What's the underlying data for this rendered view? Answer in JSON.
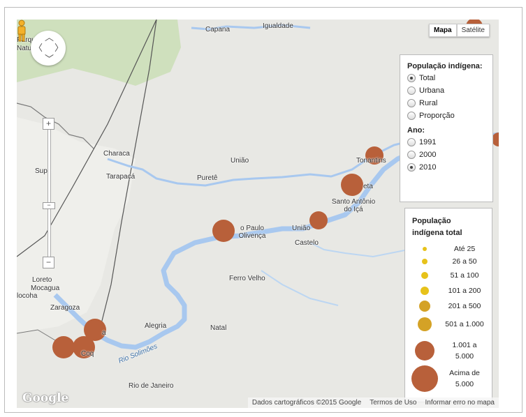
{
  "map": {
    "places": {
      "capana": "Capana",
      "igualdade": "Igualdade",
      "parque": "Parque",
      "natural": "Natura",
      "characa": "Characa",
      "uniao1": "União",
      "tarapaca": "Tarapacá",
      "purete": "Puretê",
      "supe": "Supe",
      "tonantins": "Tonantins",
      "neta": "eta",
      "santo_antonio": "Santo Antônio",
      "do_ica": "do Içá",
      "sao_paulo": "o Paulo",
      "olivenca": "Olivença",
      "uniao2": "União",
      "castelo": "Castelo",
      "loreto": "Loreto",
      "mocagua": "Mocagua",
      "jococha": "locoha",
      "zaragoza": "Zaragoza",
      "ferro_velho": "Ferro Velho",
      "alegria": "Alegria",
      "natal": "Natal",
      "rio_janeiro": "Rio de Janeiro",
      "rio_solimoes": "Rio Solimões",
      "comunidade": "Coq",
      "a": "a"
    },
    "bubble_color": "#b8603a",
    "type_control": {
      "map": "Mapa",
      "satellite": "Satélite"
    },
    "zoom": {
      "plus": "+",
      "minus": "−"
    },
    "footer": {
      "data": "Dados cartográficos ©2015 Google",
      "terms": "Termos de Uso",
      "report": "Informar erro no mapa"
    },
    "logo": "Google"
  },
  "controls": {
    "population_title": "População indígena:",
    "population_options": [
      {
        "label": "Total",
        "selected": true
      },
      {
        "label": "Urbana",
        "selected": false
      },
      {
        "label": "Rural",
        "selected": false
      },
      {
        "label": "Proporção",
        "selected": false
      }
    ],
    "year_title": "Ano:",
    "year_options": [
      {
        "label": "1991",
        "selected": false
      },
      {
        "label": "2000",
        "selected": false
      },
      {
        "label": "2010",
        "selected": true
      }
    ]
  },
  "legend": {
    "title_line1": "População",
    "title_line2": "indígena total",
    "items": [
      {
        "label": "Até 25"
      },
      {
        "label": "26 a 50"
      },
      {
        "label": "51 a 100"
      },
      {
        "label": "101 a 200"
      },
      {
        "label": "201 a 500"
      },
      {
        "label": "501 a 1.000"
      },
      {
        "label1": "1.001 a",
        "label2": "5.000"
      },
      {
        "label1": "Acima de",
        "label2": "5.000"
      }
    ]
  }
}
